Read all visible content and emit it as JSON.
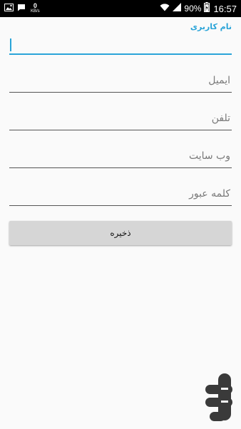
{
  "status_bar": {
    "net_speed_value": "0",
    "net_speed_unit": "KB/s",
    "battery": "90%",
    "time": "16:57"
  },
  "form": {
    "username_label": "نام کاربری",
    "username_value": "",
    "email_placeholder": "ایمیل",
    "phone_placeholder": "تلفن",
    "website_placeholder": "وب سایت",
    "password_placeholder": "کلمه عبور"
  },
  "save_button": {
    "label": "ذخیره"
  },
  "colors": {
    "accent": "#2aa4d8",
    "button_bg": "#d6d6d6",
    "background": "#fafafa"
  }
}
